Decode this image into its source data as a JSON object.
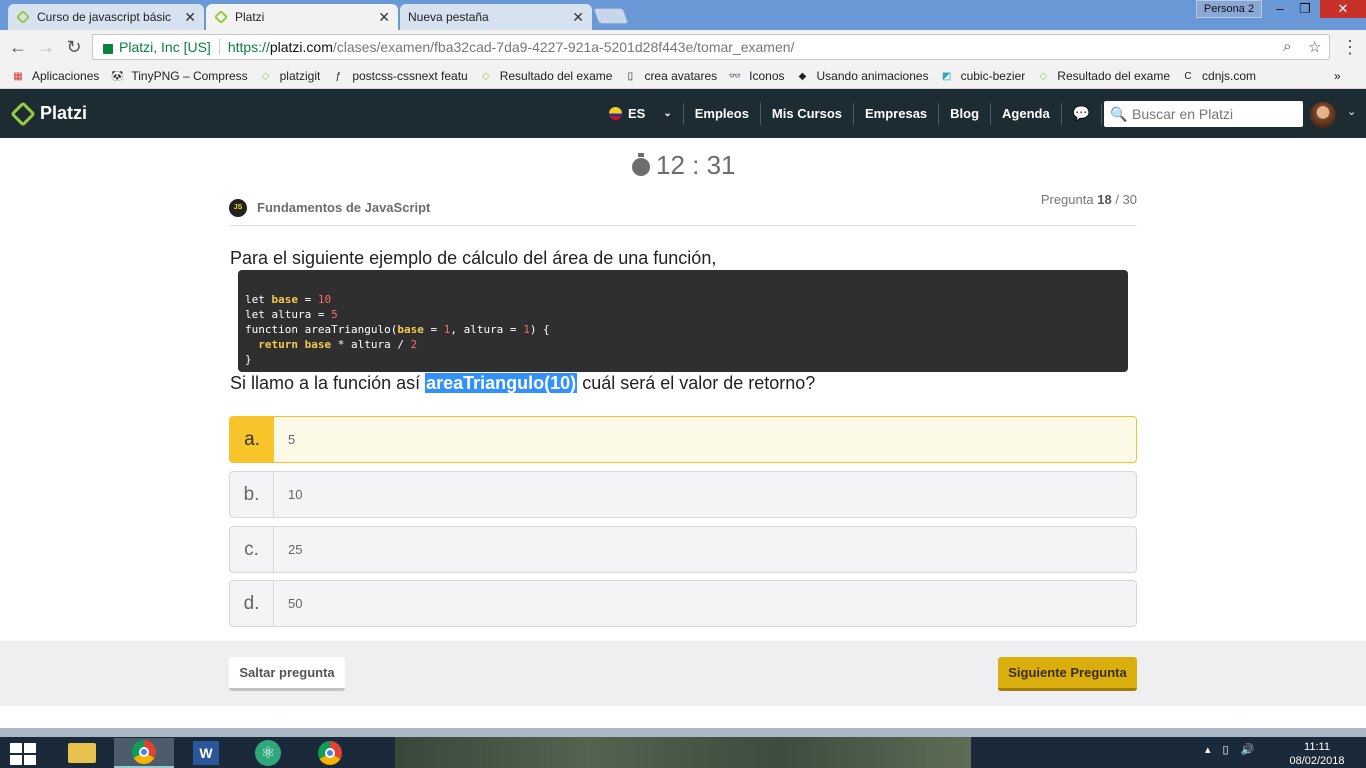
{
  "browser": {
    "tabs": [
      {
        "title": "Curso de javascript básic"
      },
      {
        "title": "Platzi"
      },
      {
        "title": "Nueva pestaña"
      }
    ],
    "profile": "Persona 2",
    "address": {
      "site": "Platzi, Inc [US]",
      "scheme": "https://",
      "domain": "platzi.com",
      "path": "/clases/examen/fba32cad-7da9-4227-921a-5201d28f443e/tomar_examen/"
    },
    "bookmarks": [
      "Aplicaciones",
      "TinyPNG – Compress",
      "platzigit",
      "postcss-cssnext featu",
      "Resultado del exame",
      "crea avatares",
      "Iconos",
      "Usando animaciones",
      "cubic-bezier",
      "Resultado del exame",
      "cdnjs.com"
    ],
    "more": "»"
  },
  "platzi": {
    "logo": "Platzi",
    "lang": "ES",
    "nav": [
      "Empleos",
      "Mis Cursos",
      "Empresas",
      "Blog",
      "Agenda"
    ],
    "search_placeholder": "Buscar en Platzi"
  },
  "exam": {
    "timer": "12 : 31",
    "course": "Fundamentos de JavaScript",
    "badge": "JS",
    "question_label": "Pregunta",
    "question_current": "18",
    "question_total": "/ 30",
    "intro": "Para el siguiente ejemplo de cálculo del área de una función,",
    "question_before": "Si llamo a la función así",
    "question_highlight": "areaTriangulo(10)",
    "question_after": "cuál será el valor de retorno?",
    "options": [
      {
        "letter": "a.",
        "value": "5",
        "selected": true
      },
      {
        "letter": "b.",
        "value": "10",
        "selected": false
      },
      {
        "letter": "c.",
        "value": "25",
        "selected": false
      },
      {
        "letter": "d.",
        "value": "50",
        "selected": false
      }
    ],
    "skip_label": "Saltar pregunta",
    "next_label": "Siguiente Pregunta"
  },
  "code": {
    "l1a": "let ",
    "l1b": "base",
    "l1c": " = ",
    "l1d": "10",
    "l2a": "let altura = ",
    "l2b": "5",
    "l3a": "function areaTriangulo(",
    "l3b": "base",
    "l3c": " = ",
    "l3d": "1",
    "l3e": ", altura = ",
    "l3f": "1",
    "l3g": ") {",
    "l4a": "  ",
    "l4b": "return",
    "l4c": " ",
    "l4d": "base",
    "l4e": " * altura / ",
    "l4f": "2",
    "l5": "}"
  },
  "taskbar": {
    "time": "11:11",
    "date": "08/02/2018"
  },
  "colors": {
    "header": "#1d2b33",
    "accent": "#98ca3f",
    "selected": "#f7c52a",
    "next_button": "#d9ae0d"
  }
}
